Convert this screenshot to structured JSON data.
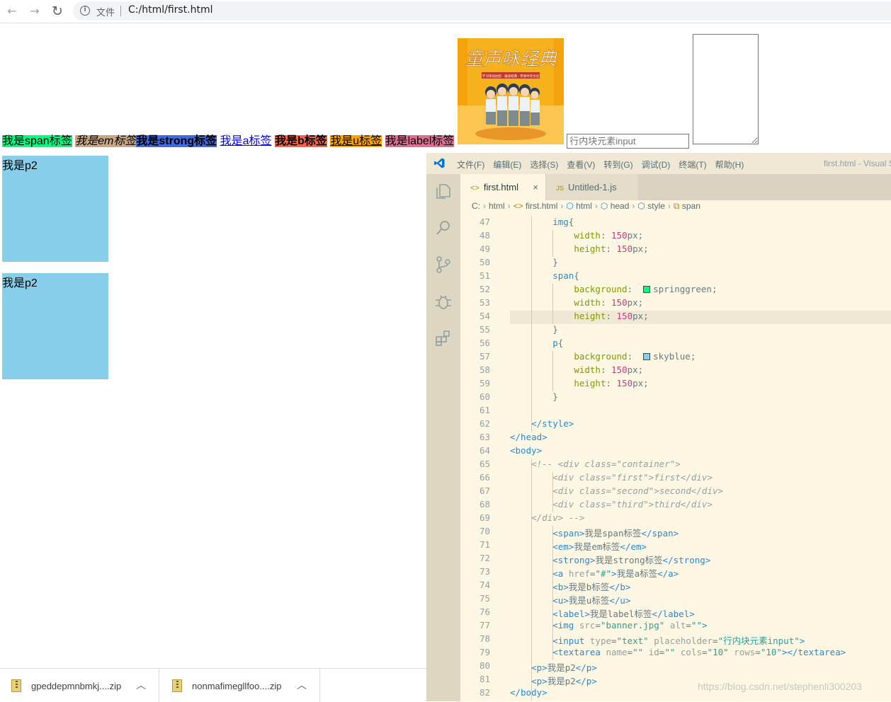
{
  "browser": {
    "back_glyph": "←",
    "forward_glyph": "→",
    "reload_glyph": "↻",
    "info_glyph": "i",
    "protocol_label": "文件",
    "url": "C:/html/first.html"
  },
  "page": {
    "span_text": "我是span标签",
    "em_text": "我是em标签",
    "strong_text": "我是strong标签",
    "a_text": "我是a标签",
    "b_text": "我是b标签",
    "u_text": "我是u标签",
    "label_text": "我是label标签",
    "banner": {
      "title": "童声咏经典",
      "subtitle": "学习诗词古韵 · 诵读经典 · 传承中华文化"
    },
    "input_placeholder": "行内块元素input",
    "p_blocks": [
      "我是p2",
      "我是p2"
    ]
  },
  "downloads": [
    {
      "name": "gpeddepmnbmkj....zip"
    },
    {
      "name": "nonmafimegllfoo....zip"
    }
  ],
  "vscode": {
    "menu": [
      "文件(F)",
      "编辑(E)",
      "选择(S)",
      "查看(V)",
      "转到(G)",
      "调试(D)",
      "终端(T)",
      "帮助(H)"
    ],
    "window_title": "first.html - Visual S",
    "tabs": [
      {
        "icon": "<>",
        "label": "first.html",
        "close": "×"
      },
      {
        "icon": "JS",
        "label": "Untitled-1.js"
      }
    ],
    "breadcrumbs": [
      "C:",
      "html",
      "first.html",
      "html",
      "head",
      "style",
      "span"
    ],
    "line_numbers": [
      "47",
      "48",
      "49",
      "50",
      "51",
      "52",
      "53",
      "54",
      "55",
      "56",
      "57",
      "58",
      "59",
      "60",
      "61",
      "62",
      "63",
      "64",
      "65",
      "66",
      "67",
      "68",
      "69",
      "70",
      "71",
      "72",
      "73",
      "74",
      "75",
      "76",
      "77",
      "78",
      "79",
      "80",
      "81",
      "82"
    ],
    "colors": {
      "springgreen": "#00ff7f",
      "skyblue": "#87ceeb"
    }
  },
  "watermark": "https://blog.csdn.net/stephenli300203"
}
